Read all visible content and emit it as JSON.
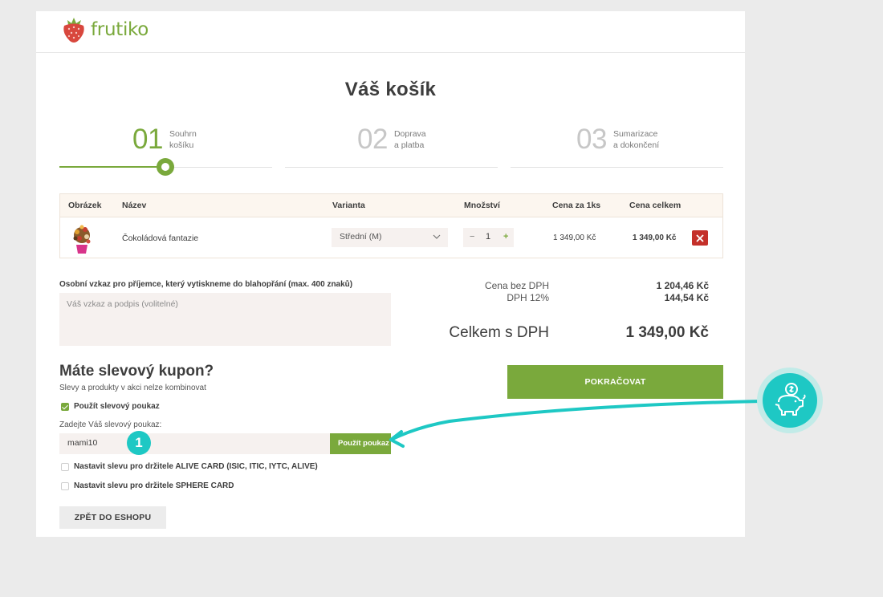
{
  "brand": {
    "name": "frutiko",
    "accent": "#7aa93c"
  },
  "page_title": "Váš košík",
  "steps": [
    {
      "num": "01",
      "line1": "Souhrn",
      "line2": "košíku"
    },
    {
      "num": "02",
      "line1": "Doprava",
      "line2": "a platba"
    },
    {
      "num": "03",
      "line1": "Sumarizace",
      "line2": "a dokončení"
    }
  ],
  "table": {
    "headers": [
      "Obrázek",
      "Název",
      "Varianta",
      "Množství",
      "Cena za 1ks",
      "Cena celkem"
    ],
    "rows": [
      {
        "name": "Čokoládová fantazie",
        "variant": "Střední (M)",
        "qty": "1",
        "unit_price": "1 349,00 Kč",
        "total": "1 349,00 Kč"
      }
    ],
    "qty_minus": "−",
    "qty_plus": "+"
  },
  "message": {
    "label": "Osobní vzkaz pro příjemce, který vytiskneme do blahopřání (max. 400 znaků)",
    "placeholder": "Váš vzkaz a podpis (volitelné)"
  },
  "totals": {
    "without_vat_label": "Cena bez DPH",
    "without_vat": "1 204,46 Kč",
    "vat_label": "DPH 12%",
    "vat": "144,54 Kč",
    "grand_label": "Celkem s DPH",
    "grand": "1 349,00 Kč"
  },
  "continue_label": "POKRAČOVAT",
  "coupon": {
    "title": "Máte slevový kupon?",
    "subtitle": "Slevy a produkty v akci nelze kombinovat",
    "use_voucher_label": "Použít slevový poukaz",
    "enter_label": "Zadejte Váš slevový poukaz:",
    "code": "mami10",
    "apply_label": "Použít poukaz",
    "alive_label": "Nastavit slevu pro držitele ALIVE CARD (ISIC, ITIC, IYTC, ALIVE)",
    "sphere_label": "Nastavit slevu pro držitele SPHERE CARD"
  },
  "back_label": "ZPĚT DO ESHOPU",
  "annotation": {
    "badge": "1",
    "color": "#1ec8c4",
    "icon": "piggy-bank-icon"
  }
}
